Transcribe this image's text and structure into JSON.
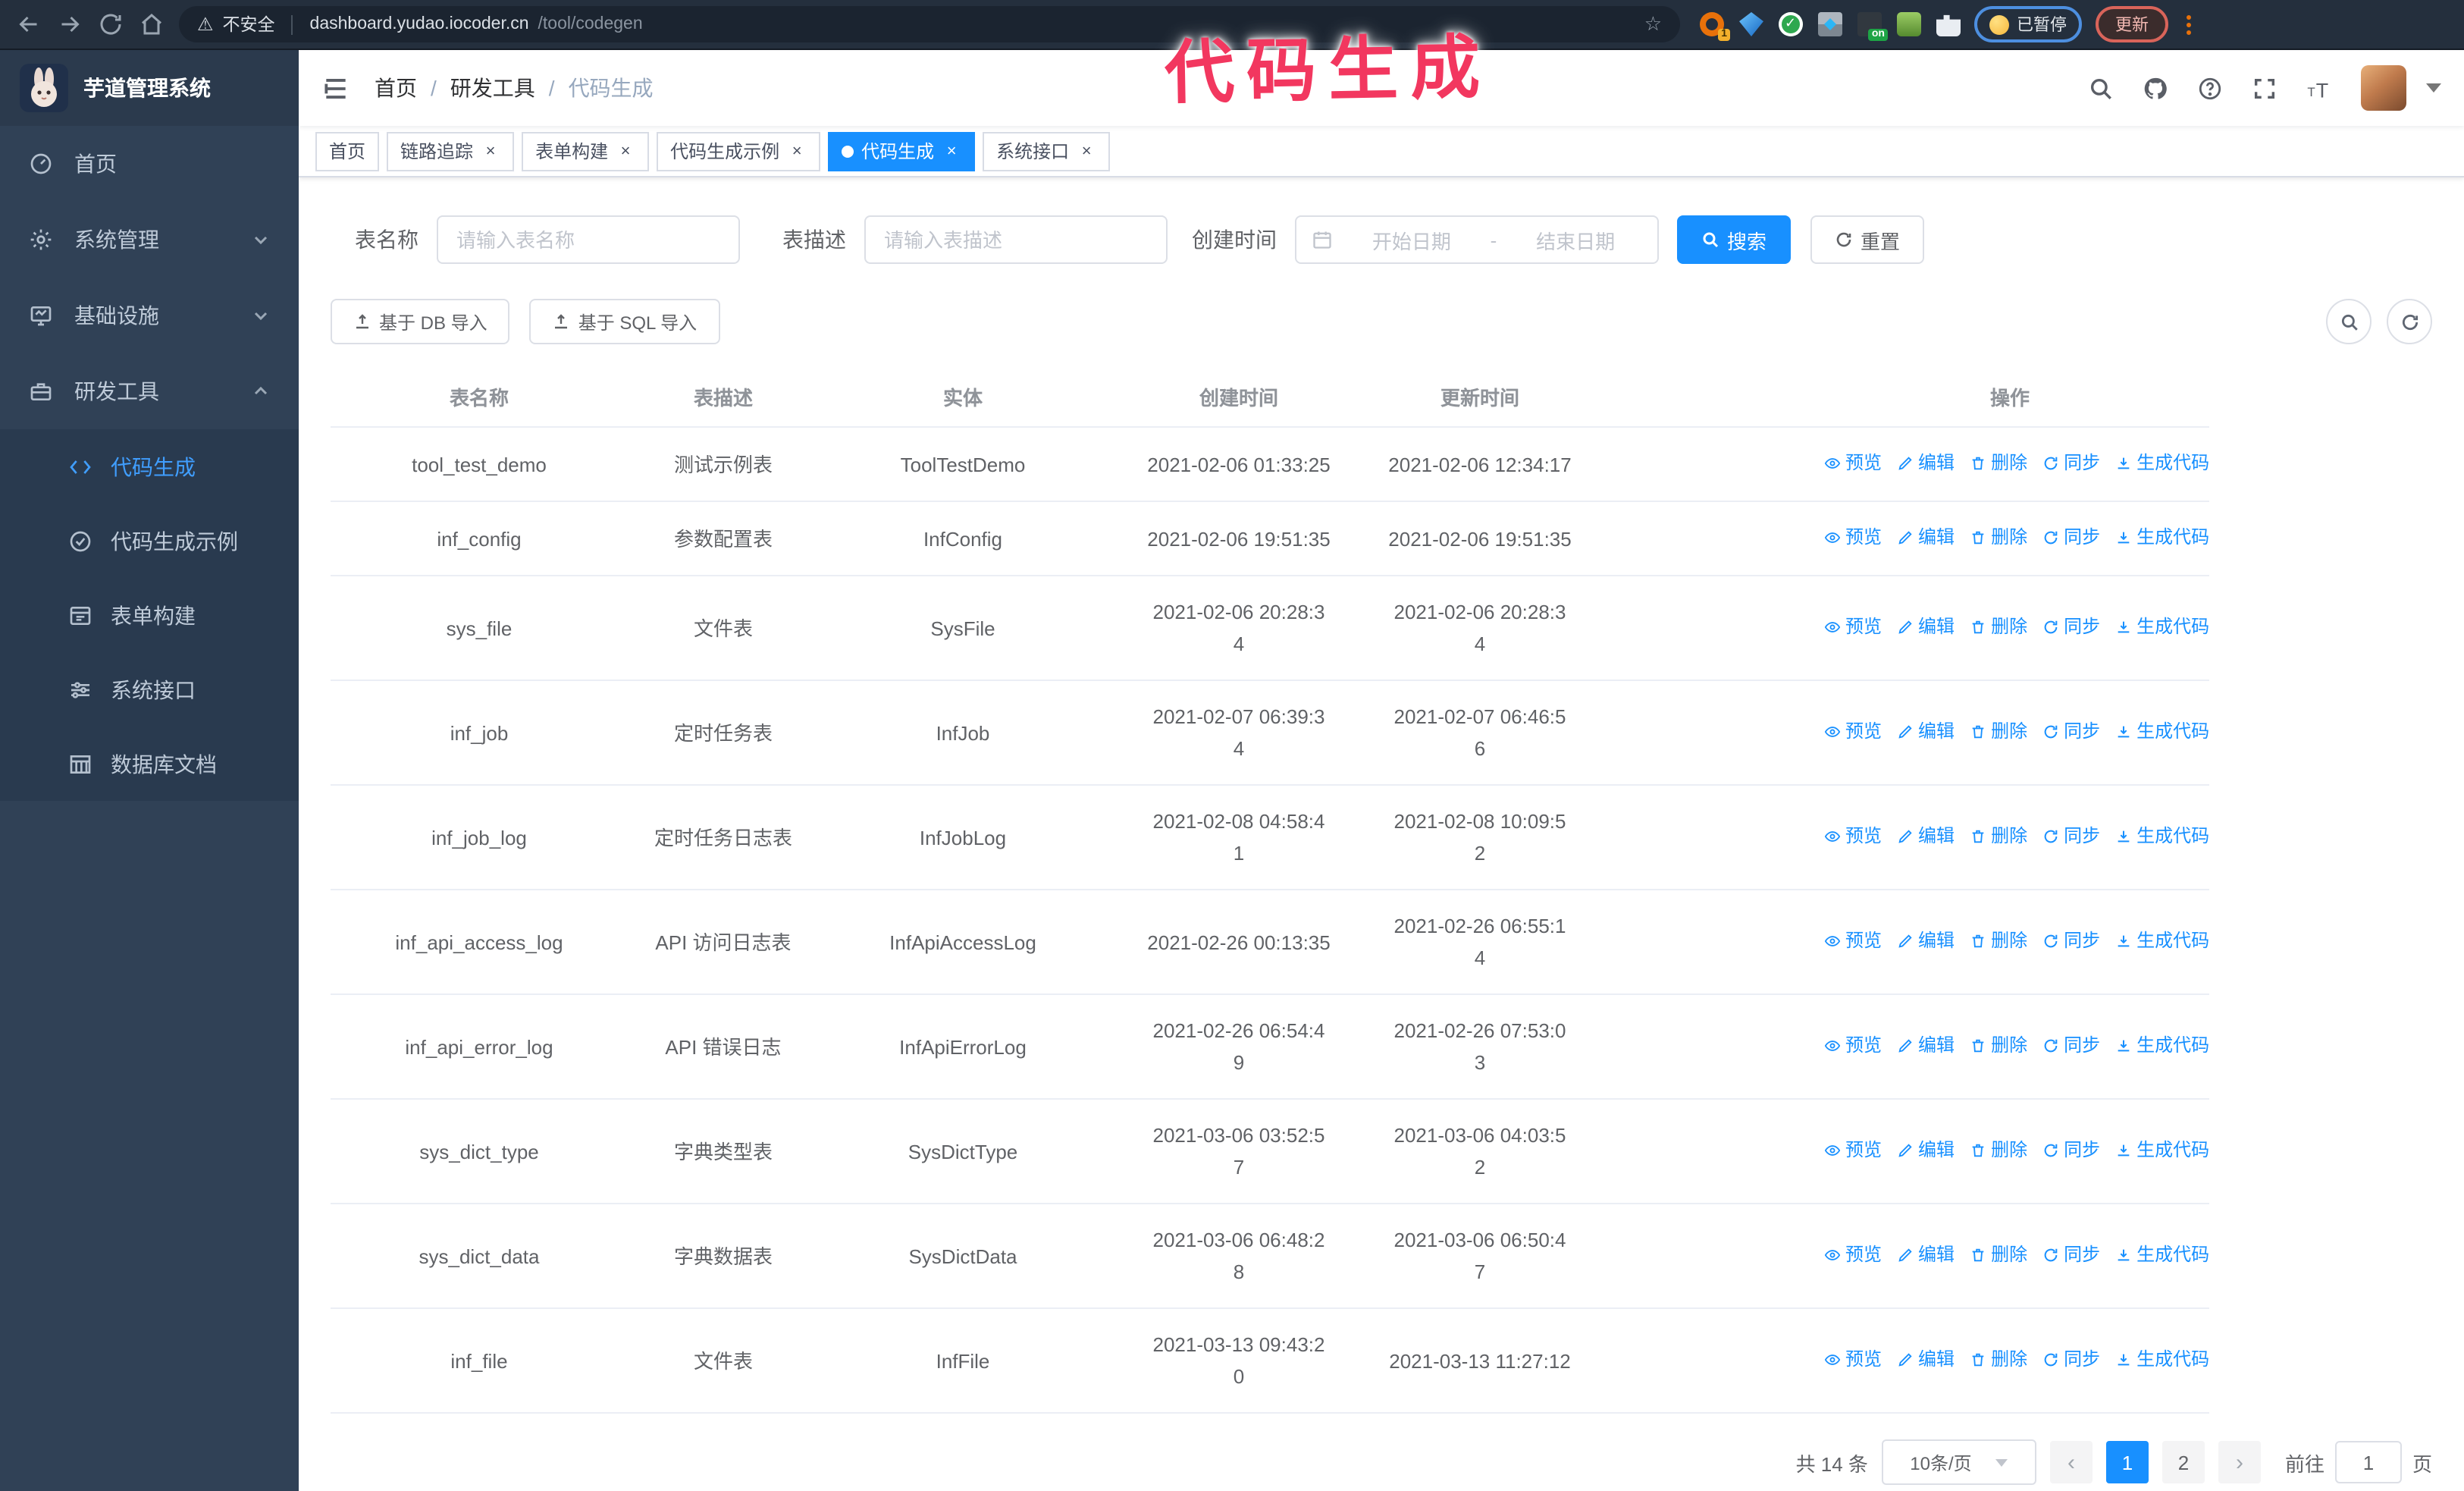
{
  "browser": {
    "security_label": "不安全",
    "url_host": "dashboard.yudao.iocoder.cn",
    "url_path": "/tool/codegen",
    "paused_badge": "已暂停",
    "update_button": "更新"
  },
  "annotation": {
    "text": "代码生成"
  },
  "app": {
    "title": "芋道管理系统"
  },
  "header": {
    "breadcrumb": [
      "首页",
      "研发工具",
      "代码生成"
    ]
  },
  "sidebar": {
    "items": [
      {
        "label": "首页"
      },
      {
        "label": "系统管理"
      },
      {
        "label": "基础设施"
      },
      {
        "label": "研发工具"
      }
    ],
    "sub_items": [
      {
        "label": "代码生成",
        "active": true
      },
      {
        "label": "代码生成示例",
        "active": false
      },
      {
        "label": "表单构建",
        "active": false
      },
      {
        "label": "系统接口",
        "active": false
      },
      {
        "label": "数据库文档",
        "active": false
      }
    ]
  },
  "tabs": [
    {
      "label": "首页",
      "closable": false,
      "active": false
    },
    {
      "label": "链路追踪",
      "closable": true,
      "active": false
    },
    {
      "label": "表单构建",
      "closable": true,
      "active": false
    },
    {
      "label": "代码生成示例",
      "closable": true,
      "active": false
    },
    {
      "label": "代码生成",
      "closable": true,
      "active": true
    },
    {
      "label": "系统接口",
      "closable": true,
      "active": false
    }
  ],
  "filters": {
    "name_label": "表名称",
    "name_placeholder": "请输入表名称",
    "desc_label": "表描述",
    "desc_placeholder": "请输入表描述",
    "time_label": "创建时间",
    "start_placeholder": "开始日期",
    "range_separator": "-",
    "end_placeholder": "结束日期",
    "search_label": "搜索",
    "reset_label": "重置"
  },
  "toolbar": {
    "import_db_label": "基于 DB 导入",
    "import_sql_label": "基于 SQL 导入"
  },
  "table": {
    "columns": [
      "表名称",
      "表描述",
      "实体",
      "创建时间",
      "更新时间",
      "操作"
    ],
    "action_labels": [
      "预览",
      "编辑",
      "删除",
      "同步",
      "生成代码"
    ],
    "rows": [
      {
        "name": "tool_test_demo",
        "desc": "测试示例表",
        "entity": "ToolTestDemo",
        "created": "2021-02-06 01:33:25",
        "updated": "2021-02-06 12:34:17"
      },
      {
        "name": "inf_config",
        "desc": "参数配置表",
        "entity": "InfConfig",
        "created": "2021-02-06 19:51:35",
        "updated": "2021-02-06 19:51:35"
      },
      {
        "name": "sys_file",
        "desc": "文件表",
        "entity": "SysFile",
        "created": "2021-02-06 20:28:3\n4",
        "updated": "2021-02-06 20:28:3\n4"
      },
      {
        "name": "inf_job",
        "desc": "定时任务表",
        "entity": "InfJob",
        "created": "2021-02-07 06:39:3\n4",
        "updated": "2021-02-07 06:46:5\n6"
      },
      {
        "name": "inf_job_log",
        "desc": "定时任务日志表",
        "entity": "InfJobLog",
        "created": "2021-02-08 04:58:4\n1",
        "updated": "2021-02-08 10:09:5\n2"
      },
      {
        "name": "inf_api_access_log",
        "desc": "API 访问日志表",
        "entity": "InfApiAccessLog",
        "created": "2021-02-26 00:13:35",
        "updated": "2021-02-26 06:55:1\n4"
      },
      {
        "name": "inf_api_error_log",
        "desc": "API 错误日志",
        "entity": "InfApiErrorLog",
        "created": "2021-02-26 06:54:4\n9",
        "updated": "2021-02-26 07:53:0\n3"
      },
      {
        "name": "sys_dict_type",
        "desc": "字典类型表",
        "entity": "SysDictType",
        "created": "2021-03-06 03:52:5\n7",
        "updated": "2021-03-06 04:03:5\n2"
      },
      {
        "name": "sys_dict_data",
        "desc": "字典数据表",
        "entity": "SysDictData",
        "created": "2021-03-06 06:48:2\n8",
        "updated": "2021-03-06 06:50:4\n7"
      },
      {
        "name": "inf_file",
        "desc": "文件表",
        "entity": "InfFile",
        "created": "2021-03-13 09:43:2\n0",
        "updated": "2021-03-13 11:27:12"
      }
    ]
  },
  "pagination": {
    "total_label": "共 14 条",
    "page_size_label": "10条/页",
    "pages": [
      "1",
      "2"
    ],
    "active_page": "1",
    "prev_label": "‹",
    "next_label": "›",
    "goto_label": "前往",
    "goto_value": "1",
    "page_suffix": "页"
  }
}
